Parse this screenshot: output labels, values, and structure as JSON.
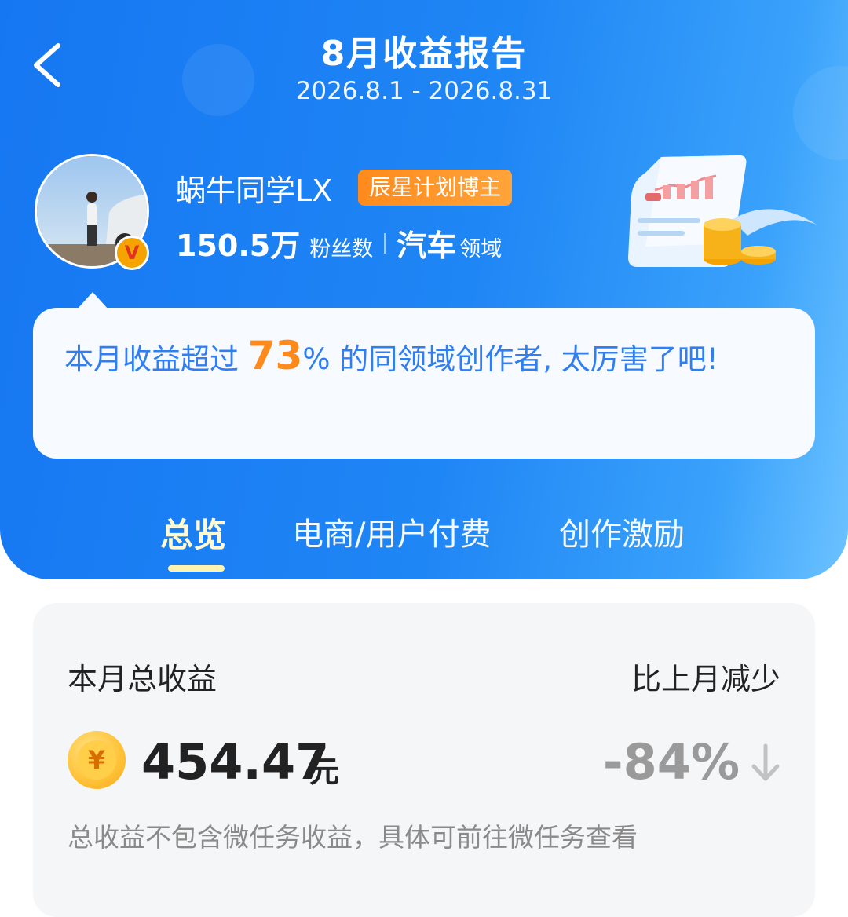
{
  "header": {
    "title": "8月收益报告",
    "date_range": "2026.8.1 - 2026.8.31",
    "back_icon": "chevron-left-icon"
  },
  "profile": {
    "name": "蜗牛同学LX",
    "badge": "辰星计划博主",
    "followers_value": "150.5万",
    "followers_label": "粉丝数",
    "domain_value": "汽车",
    "domain_label": "领域",
    "verify_mark": "V"
  },
  "bubble": {
    "prefix": "本月收益超过",
    "percent": "73",
    "suffix": "% 的同领域创作者, 太厉害了吧!"
  },
  "tabs": [
    {
      "label": "总览",
      "active": true
    },
    {
      "label": "电商/用户付费",
      "active": false
    },
    {
      "label": "创作激励",
      "active": false
    }
  ],
  "summary": {
    "total_label": "本月总收益",
    "compare_label": "比上月减少",
    "currency_symbol": "¥",
    "amount": "454.47",
    "unit": "元",
    "change": "-84%",
    "note": "总收益不包含微任务收益，具体可前往微任务查看"
  },
  "colors": {
    "header_blue": "#1677f2",
    "highlight_orange": "#ff8a1c",
    "bubble_text": "#2f7ff2",
    "tab_active": "#fff8d0"
  }
}
